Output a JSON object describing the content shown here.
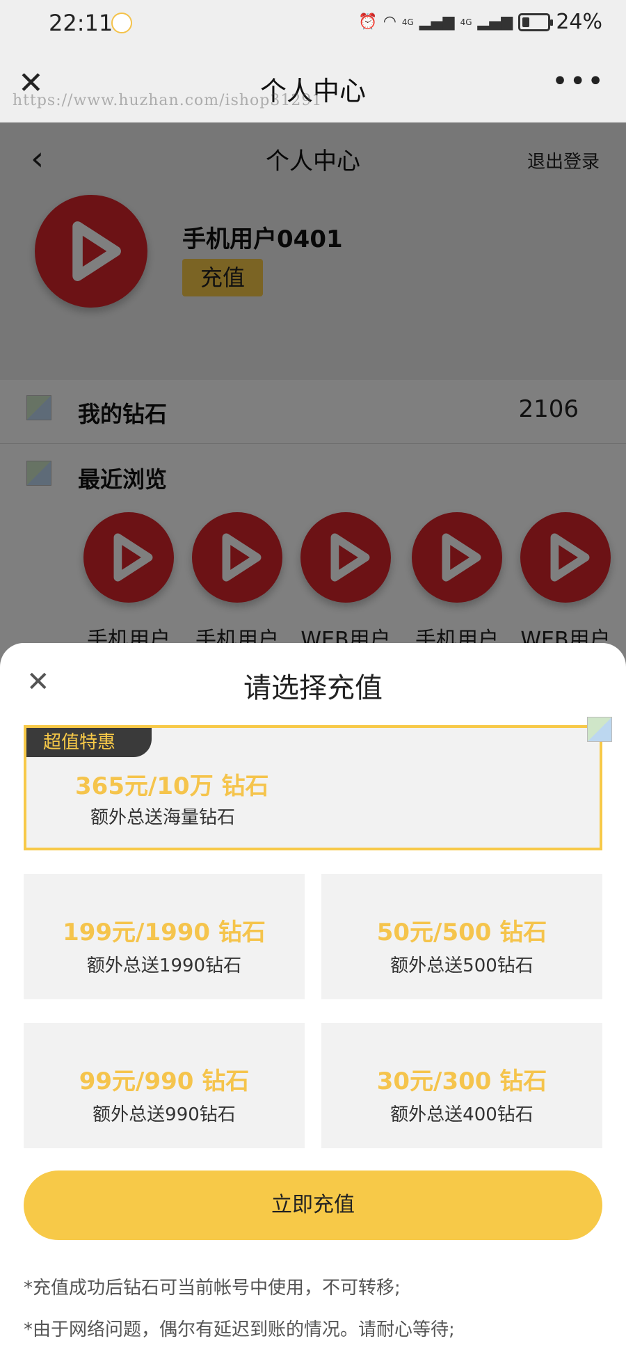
{
  "status_bar": {
    "time": "22:11",
    "network_1": "4G",
    "network_2": "4G",
    "battery_percent": "24%",
    "battery_level": 0.24,
    "icons": [
      "alarm-icon",
      "wifi-icon",
      "signal-icon",
      "signal-icon",
      "battery-icon"
    ]
  },
  "browser": {
    "title": "个人中心",
    "close_icon": "close-icon",
    "more_icon": "more-icon",
    "watermark": "https://www.huzhan.com/ishop31291"
  },
  "page": {
    "title": "个人中心",
    "logout_label": "退出登录",
    "user_name": "手机用户0401",
    "recharge_label": "充值",
    "my_diamonds_label": "我的钻石",
    "my_diamonds_value": "2106",
    "recent_label": "最近浏览",
    "recent_items": [
      {
        "name": "手机用户"
      },
      {
        "name": "手机用户"
      },
      {
        "name": "WEB用户"
      },
      {
        "name": "手机用户"
      },
      {
        "name": "WEB用户"
      }
    ]
  },
  "sheet": {
    "title": "请选择充值",
    "featured": {
      "badge": "超值特惠",
      "price": "365元/10万 钻石",
      "desc": "额外总送海量钻石"
    },
    "options": [
      {
        "price": "199元/1990 钻石",
        "desc": "额外总送1990钻石"
      },
      {
        "price": "50元/500 钻石",
        "desc": "额外总送500钻石"
      },
      {
        "price": "99元/990 钻石",
        "desc": "额外总送990钻石"
      },
      {
        "price": "30元/300 钻石",
        "desc": "额外总送400钻石"
      }
    ],
    "pay_button": "立即充值",
    "notes": [
      "*充值成功后钻石可当前帐号中使用，不可转移;",
      "*由于网络问题，偶尔有延迟到账的情况。请耐心等待;"
    ]
  },
  "colors": {
    "accent": "#f7c948",
    "price": "#f5c44c",
    "brand_red": "#d9252b"
  }
}
